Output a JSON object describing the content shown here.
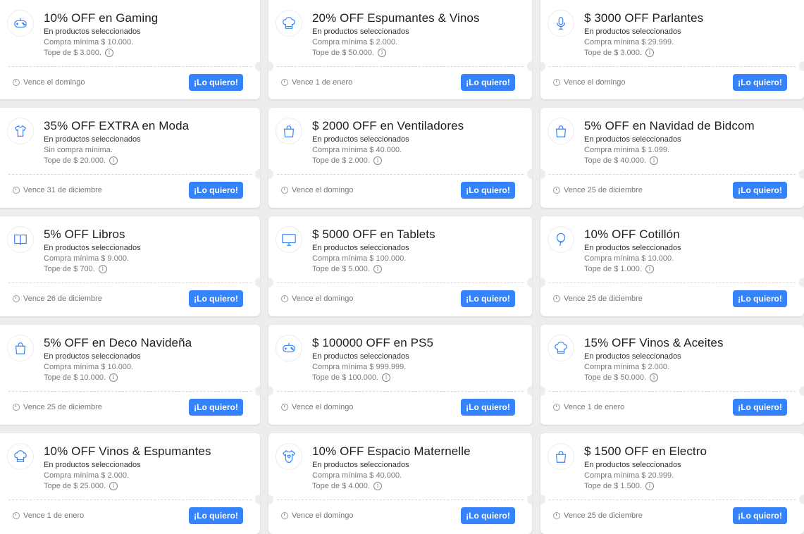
{
  "accent_color": "#3483fa",
  "coupons": [
    {
      "icon": "gamepad-icon",
      "title": "10% OFF en Gaming",
      "subtitle": "En productos seleccionados",
      "line2": "Compra mínima $ 10.000.",
      "line3": "Tope de $ 3.000.",
      "expiry": "Vence el domingo",
      "button": "¡Lo quiero!"
    },
    {
      "icon": "chef-hat-icon",
      "title": "20% OFF Espumantes & Vinos",
      "subtitle": "En productos seleccionados",
      "line2": "Compra mínima $ 2.000.",
      "line3": "Tope de $ 50.000.",
      "expiry": "Vence 1 de enero",
      "button": "¡Lo quiero!"
    },
    {
      "icon": "microphone-icon",
      "title": "$ 3000 OFF Parlantes",
      "subtitle": "En productos seleccionados",
      "line2": "Compra mínima $ 29.999.",
      "line3": "Tope de $ 3.000.",
      "expiry": "Vence el domingo",
      "button": "¡Lo quiero!"
    },
    {
      "icon": "tshirt-icon",
      "title": "35% OFF EXTRA en Moda",
      "subtitle": "En productos seleccionados",
      "line2": "Sin compra mínima.",
      "line3": "Tope de $ 20.000.",
      "expiry": "Vence 31 de diciembre",
      "button": "¡Lo quiero!"
    },
    {
      "icon": "shopping-bag-icon",
      "title": "$ 2000 OFF en Ventiladores",
      "subtitle": "En productos seleccionados",
      "line2": "Compra mínima $ 40.000.",
      "line3": "Tope de $ 2.000.",
      "expiry": "Vence el domingo",
      "button": "¡Lo quiero!"
    },
    {
      "icon": "shopping-bag-icon",
      "title": "5% OFF en Navidad de Bidcom",
      "subtitle": "En productos seleccionados",
      "line2": "Compra mínima $ 1.099.",
      "line3": "Tope de $ 40.000.",
      "expiry": "Vence 25 de diciembre",
      "button": "¡Lo quiero!"
    },
    {
      "icon": "book-icon",
      "title": "5% OFF Libros",
      "subtitle": "En productos seleccionados",
      "line2": "Compra mínima $ 9.000.",
      "line3": "Tope de $ 700.",
      "expiry": "Vence 26 de diciembre",
      "button": "¡Lo quiero!"
    },
    {
      "icon": "monitor-icon",
      "title": "$ 5000 OFF en Tablets",
      "subtitle": "En productos seleccionados",
      "line2": "Compra mínima $ 100.000.",
      "line3": "Tope de $ 5.000.",
      "expiry": "Vence el domingo",
      "button": "¡Lo quiero!"
    },
    {
      "icon": "balloon-icon",
      "title": "10% OFF Cotillón",
      "subtitle": "En productos seleccionados",
      "line2": "Compra mínima $ 10.000.",
      "line3": "Tope de $ 1.000.",
      "expiry": "Vence 25 de diciembre",
      "button": "¡Lo quiero!"
    },
    {
      "icon": "shopping-bag-icon",
      "title": "5% OFF en Deco Navideña",
      "subtitle": "En productos seleccionados",
      "line2": "Compra mínima $ 10.000.",
      "line3": "Tope de $ 10.000.",
      "expiry": "Vence 25 de diciembre",
      "button": "¡Lo quiero!"
    },
    {
      "icon": "gamepad-icon",
      "title": "$ 100000 OFF en PS5",
      "subtitle": "En productos seleccionados",
      "line2": "Compra mínima $ 999.999.",
      "line3": "Tope de $ 100.000.",
      "expiry": "Vence el domingo",
      "button": "¡Lo quiero!"
    },
    {
      "icon": "chef-hat-icon",
      "title": "15% OFF Vinos & Aceites",
      "subtitle": "En productos seleccionados",
      "line2": "Compra mínima $ 2.000.",
      "line3": "Tope de $ 50.000.",
      "expiry": "Vence 1 de enero",
      "button": "¡Lo quiero!"
    },
    {
      "icon": "chef-hat-icon",
      "title": "10% OFF Vinos & Espumantes",
      "subtitle": "En productos seleccionados",
      "line2": "Compra mínima $ 2.000.",
      "line3": "Tope de $ 25.000.",
      "expiry": "Vence 1 de enero",
      "button": "¡Lo quiero!"
    },
    {
      "icon": "baby-bodysuit-icon",
      "title": "10% OFF Espacio Maternelle",
      "subtitle": "En productos seleccionados",
      "line2": "Compra mínima $ 40.000.",
      "line3": "Tope de $ 4.000.",
      "expiry": "Vence el domingo",
      "button": "¡Lo quiero!"
    },
    {
      "icon": "shopping-bag-icon",
      "title": "$ 1500 OFF en Electro",
      "subtitle": "En productos seleccionados",
      "line2": "Compra mínima $ 20.999.",
      "line3": "Tope de $ 1.500.",
      "expiry": "Vence 25 de diciembre",
      "button": "¡Lo quiero!"
    }
  ]
}
